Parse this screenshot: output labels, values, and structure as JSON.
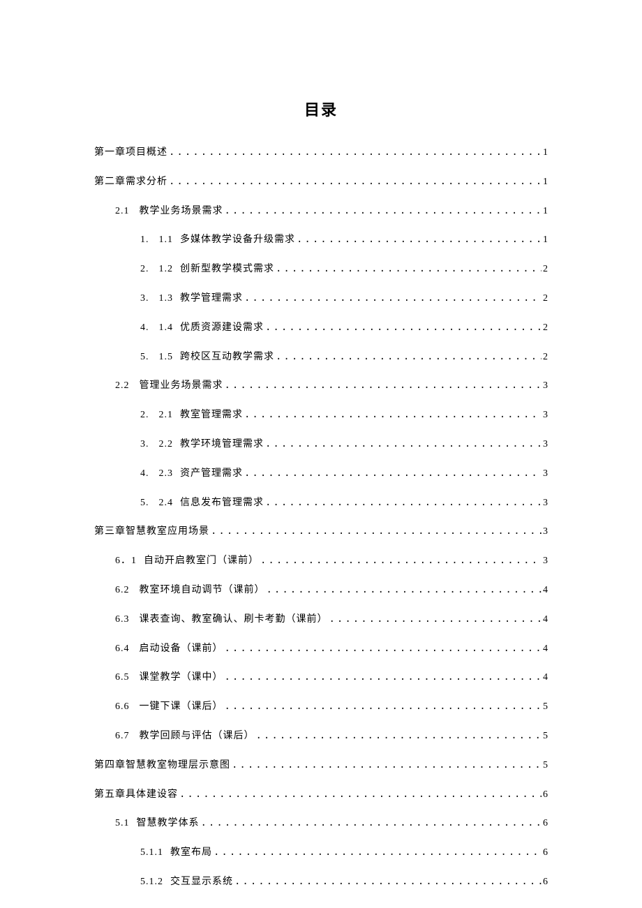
{
  "title": "目录",
  "toc": [
    {
      "level": 0,
      "label": "第一章项目概述",
      "page": "1"
    },
    {
      "level": 0,
      "label": "第二章需求分析",
      "page": "1"
    },
    {
      "level": 1,
      "num": "2.1",
      "label": "教学业务场景需求",
      "page": "1"
    },
    {
      "level": 2,
      "num": "1.",
      "sub": "1.1",
      "label": "多媒体教学设备升级需求",
      "page": "1"
    },
    {
      "level": 2,
      "num": "2.",
      "sub": "1.2",
      "label": "创新型教学模式需求",
      "page": "2"
    },
    {
      "level": 2,
      "num": "3.",
      "sub": "1.3",
      "label": "教学管理需求",
      "page": "2"
    },
    {
      "level": 2,
      "num": "4.",
      "sub": "1.4",
      "label": "优质资源建设需求",
      "page": "2"
    },
    {
      "level": 2,
      "num": "5.",
      "sub": "1.5",
      "label": "跨校区互动教学需求",
      "page": "2"
    },
    {
      "level": 1,
      "num": "2.2",
      "label": "管理业务场景需求",
      "page": "3"
    },
    {
      "level": 2,
      "num": "2.",
      "sub": "2.1",
      "label": "教室管理需求",
      "page": "3"
    },
    {
      "level": 2,
      "num": "3.",
      "sub": "2.2",
      "label": "教学环境管理需求",
      "page": "3"
    },
    {
      "level": 2,
      "num": "4.",
      "sub": "2.3",
      "label": "资产管理需求",
      "page": "3"
    },
    {
      "level": 2,
      "num": "5.",
      "sub": "2.4",
      "label": "信息发布管理需求",
      "page": "3"
    },
    {
      "level": 0,
      "label": "第三章智慧教室应用场景",
      "page": "3"
    },
    {
      "level": 1,
      "num": "6．1",
      "label": "自动开启教室门（课前）",
      "page": "3",
      "style": "fused"
    },
    {
      "level": 1,
      "num": "6.2",
      "label": "教室环境自动调节（课前）",
      "page": "4"
    },
    {
      "level": 1,
      "num": "6.3",
      "label": "课表查询、教室确认、刷卡考勤（课前）",
      "page": "4"
    },
    {
      "level": 1,
      "num": "6.4",
      "label": "启动设备（课前）",
      "page": "4"
    },
    {
      "level": 1,
      "num": "6.5",
      "label": "课堂教学（课中）",
      "page": "4"
    },
    {
      "level": 1,
      "num": "6.6",
      "label": "一键下课（课后）",
      "page": "5"
    },
    {
      "level": 1,
      "num": "6.7",
      "label": "教学回顾与评估（课后）",
      "page": "5"
    },
    {
      "level": 0,
      "label": "第四章智慧教室物理层示意图",
      "page": "5"
    },
    {
      "level": 0,
      "label": "第五章具体建设容",
      "page": "6"
    },
    {
      "level": 1,
      "num": "5.1",
      "label": "智慧教学体系",
      "page": "6",
      "style": "tight"
    },
    {
      "level": 2,
      "sub": "5.1.1",
      "label": "教室布局",
      "page": "6",
      "style": "plain"
    },
    {
      "level": 2,
      "sub": "5.1.2",
      "label": "交互显示系统",
      "page": "6",
      "style": "plain"
    }
  ]
}
